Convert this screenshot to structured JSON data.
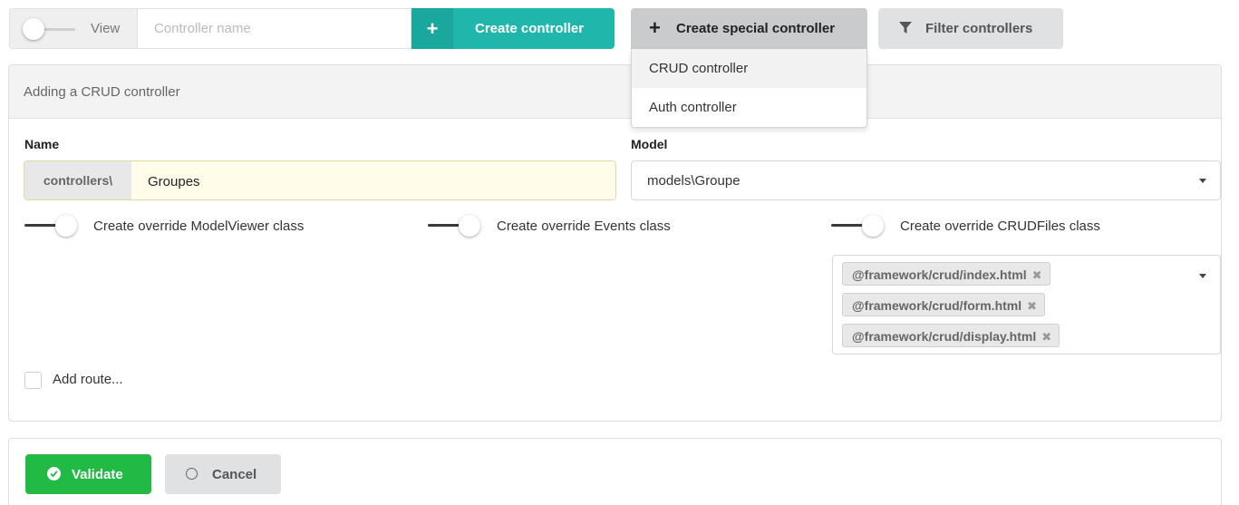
{
  "toolbar": {
    "view_label": "View",
    "controller_name_placeholder": "Controller name",
    "create_label": "Create controller",
    "special_label": "Create special controller",
    "filter_label": "Filter controllers"
  },
  "special_menu": {
    "items": [
      "CRUD controller",
      "Auth controller"
    ],
    "active_index": 0
  },
  "form": {
    "header": "Adding a CRUD controller",
    "name_label": "Name",
    "name_prefix": "controllers\\",
    "name_value": "Groupes",
    "model_label": "Model",
    "model_value": "models\\Groupe",
    "switches": [
      {
        "label": "Create override ModelViewer class",
        "on": false
      },
      {
        "label": "Create override Events class",
        "on": false
      },
      {
        "label": "Create override CRUDFiles class",
        "on": false
      }
    ],
    "crud_files": [
      "@framework/crud/index.html",
      "@framework/crud/form.html",
      "@framework/crud/display.html"
    ],
    "add_route_label": "Add route...",
    "add_route_checked": false
  },
  "actions": {
    "validate_label": "Validate",
    "cancel_label": "Cancel"
  },
  "colors": {
    "teal": "#21b6ac",
    "green": "#21ba45",
    "highlight_input": "#fffdea"
  }
}
